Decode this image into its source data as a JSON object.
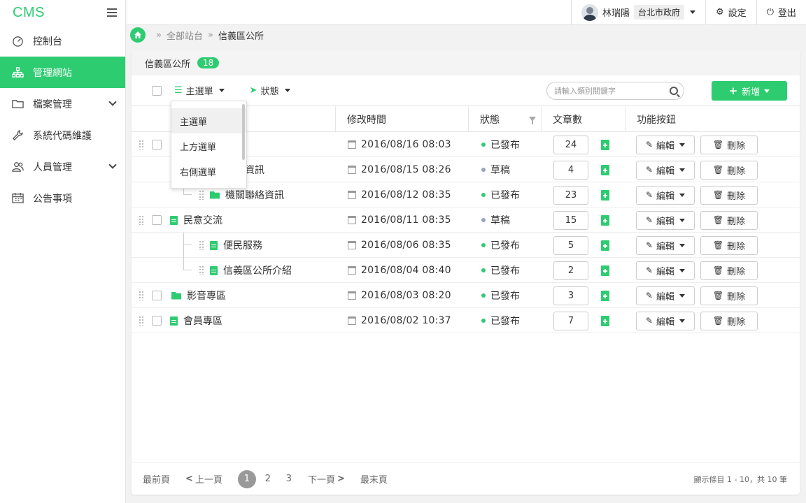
{
  "brand": "CMS",
  "sidebar": {
    "items": [
      {
        "label": "控制台",
        "icon": "dashboard-icon"
      },
      {
        "label": "管理網站",
        "icon": "sitemap-icon",
        "active": true
      },
      {
        "label": "檔案管理",
        "icon": "folder-icon",
        "expandable": true
      },
      {
        "label": "系統代碼維護",
        "icon": "wrench-icon"
      },
      {
        "label": "人員管理",
        "icon": "users-icon",
        "expandable": true
      },
      {
        "label": "公告事項",
        "icon": "calendar-icon"
      }
    ]
  },
  "topbar": {
    "user_name": "林瑞陽",
    "org": "台北市政府",
    "settings_label": "設定",
    "logout_label": "登出"
  },
  "breadcrumb": {
    "items": [
      "全部站台",
      "信義區公所"
    ]
  },
  "panel": {
    "title": "信義區公所",
    "count": "18"
  },
  "toolbar": {
    "menu_filter_label": "主選單",
    "status_filter_label": "狀態",
    "search_placeholder": "請輸入類別關鍵字",
    "add_label": "新增"
  },
  "dropdown": {
    "options": [
      "主選單",
      "上方選單",
      "右側選單"
    ]
  },
  "table": {
    "columns": [
      "修改時間",
      "狀態",
      "文章數",
      "功能按鈕"
    ],
    "edit_label": "編輯",
    "delete_label": "刪除",
    "rows": [
      {
        "name": "",
        "type": "folder",
        "level": 0,
        "time": "2016/08/16 08:03",
        "status": "已發布",
        "count": "24"
      },
      {
        "name": "業務資訊",
        "type": "folder",
        "level": 1,
        "time": "2016/08/15 08:26",
        "status": "草稿",
        "count": "4"
      },
      {
        "name": "機關聯絡資訊",
        "type": "folder",
        "level": 1,
        "time": "2016/08/12 08:35",
        "status": "已發布",
        "count": "23"
      },
      {
        "name": "民意交流",
        "type": "doc",
        "level": 0,
        "time": "2016/08/11 08:35",
        "status": "草稿",
        "count": "15"
      },
      {
        "name": "便民服務",
        "type": "doc",
        "level": 1,
        "time": "2016/08/06 08:35",
        "status": "已發布",
        "count": "5"
      },
      {
        "name": "信義區公所介紹",
        "type": "doc",
        "level": 1,
        "time": "2016/08/04 08:40",
        "status": "已發布",
        "count": "2"
      },
      {
        "name": "影音專區",
        "type": "folder",
        "level": 0,
        "time": "2016/08/03 08:20",
        "status": "已發布",
        "count": "3"
      },
      {
        "name": "會員專區",
        "type": "doc",
        "level": 0,
        "time": "2016/08/02 10:37",
        "status": "已發布",
        "count": "7"
      }
    ]
  },
  "pager": {
    "first": "最前頁",
    "prev": "上一頁",
    "pages": [
      "1",
      "2",
      "3"
    ],
    "next": "下一頁",
    "last": "最末頁",
    "info": "顯示條目 1 - 10，共 10 筆"
  },
  "colors": {
    "accent": "#2ecc71",
    "published": "#2ecc71",
    "draft": "#9aa4c4"
  }
}
